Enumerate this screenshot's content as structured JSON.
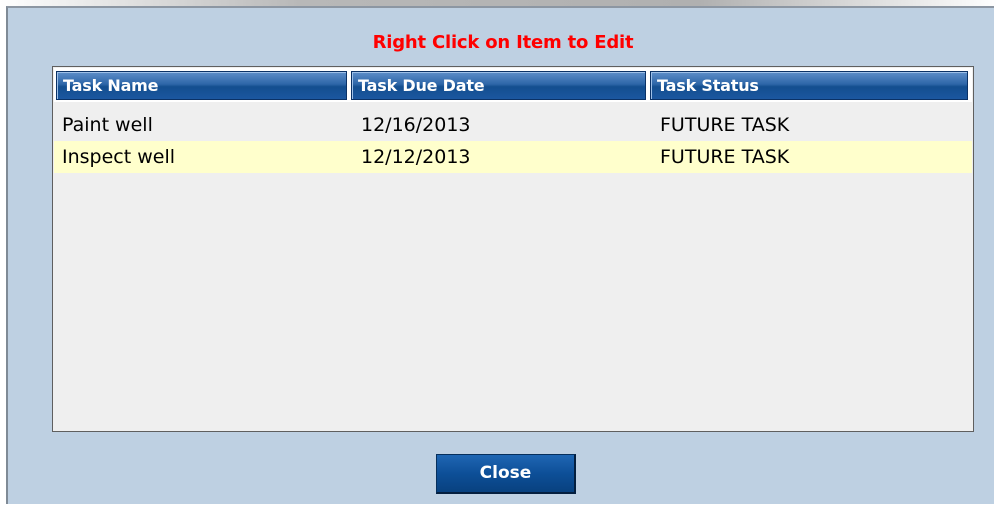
{
  "dialog": {
    "title": "Right Click on Item to Edit",
    "title_color": "#ff0000",
    "background_color": "#bed0e2"
  },
  "task_table": {
    "columns": [
      "Task Name",
      "Task Due Date",
      "Task Status"
    ],
    "header_color": "#1b57a0",
    "selected_row_color": "#ffffcc",
    "rows": [
      {
        "name": "Paint well",
        "due_date": "12/16/2013",
        "status": "FUTURE TASK"
      },
      {
        "name": "Inspect well",
        "due_date": "12/12/2013",
        "status": "FUTURE TASK"
      }
    ]
  },
  "buttons": {
    "close_label": "Close"
  }
}
